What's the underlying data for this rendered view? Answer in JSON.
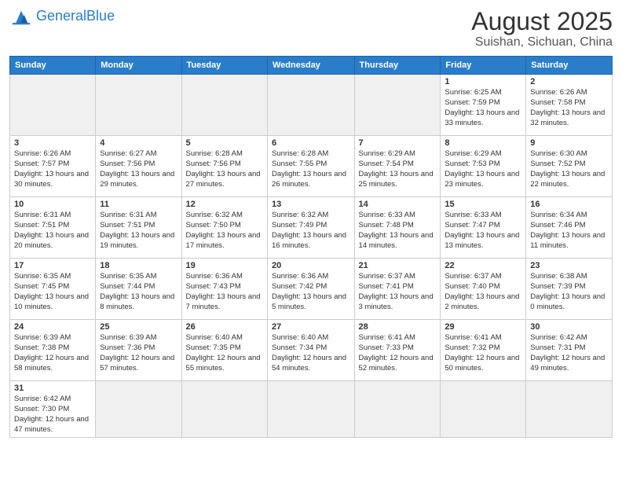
{
  "header": {
    "logo_general": "General",
    "logo_blue": "Blue",
    "title": "August 2025",
    "subtitle": "Suishan, Sichuan, China"
  },
  "days_of_week": [
    "Sunday",
    "Monday",
    "Tuesday",
    "Wednesday",
    "Thursday",
    "Friday",
    "Saturday"
  ],
  "weeks": [
    [
      {
        "day": "",
        "detail": ""
      },
      {
        "day": "",
        "detail": ""
      },
      {
        "day": "",
        "detail": ""
      },
      {
        "day": "",
        "detail": ""
      },
      {
        "day": "",
        "detail": ""
      },
      {
        "day": "1",
        "detail": "Sunrise: 6:25 AM\nSunset: 7:59 PM\nDaylight: 13 hours and 33 minutes."
      },
      {
        "day": "2",
        "detail": "Sunrise: 6:26 AM\nSunset: 7:58 PM\nDaylight: 13 hours and 32 minutes."
      }
    ],
    [
      {
        "day": "3",
        "detail": "Sunrise: 6:26 AM\nSunset: 7:57 PM\nDaylight: 13 hours and 30 minutes."
      },
      {
        "day": "4",
        "detail": "Sunrise: 6:27 AM\nSunset: 7:56 PM\nDaylight: 13 hours and 29 minutes."
      },
      {
        "day": "5",
        "detail": "Sunrise: 6:28 AM\nSunset: 7:56 PM\nDaylight: 13 hours and 27 minutes."
      },
      {
        "day": "6",
        "detail": "Sunrise: 6:28 AM\nSunset: 7:55 PM\nDaylight: 13 hours and 26 minutes."
      },
      {
        "day": "7",
        "detail": "Sunrise: 6:29 AM\nSunset: 7:54 PM\nDaylight: 13 hours and 25 minutes."
      },
      {
        "day": "8",
        "detail": "Sunrise: 6:29 AM\nSunset: 7:53 PM\nDaylight: 13 hours and 23 minutes."
      },
      {
        "day": "9",
        "detail": "Sunrise: 6:30 AM\nSunset: 7:52 PM\nDaylight: 13 hours and 22 minutes."
      }
    ],
    [
      {
        "day": "10",
        "detail": "Sunrise: 6:31 AM\nSunset: 7:51 PM\nDaylight: 13 hours and 20 minutes."
      },
      {
        "day": "11",
        "detail": "Sunrise: 6:31 AM\nSunset: 7:51 PM\nDaylight: 13 hours and 19 minutes."
      },
      {
        "day": "12",
        "detail": "Sunrise: 6:32 AM\nSunset: 7:50 PM\nDaylight: 13 hours and 17 minutes."
      },
      {
        "day": "13",
        "detail": "Sunrise: 6:32 AM\nSunset: 7:49 PM\nDaylight: 13 hours and 16 minutes."
      },
      {
        "day": "14",
        "detail": "Sunrise: 6:33 AM\nSunset: 7:48 PM\nDaylight: 13 hours and 14 minutes."
      },
      {
        "day": "15",
        "detail": "Sunrise: 6:33 AM\nSunset: 7:47 PM\nDaylight: 13 hours and 13 minutes."
      },
      {
        "day": "16",
        "detail": "Sunrise: 6:34 AM\nSunset: 7:46 PM\nDaylight: 13 hours and 11 minutes."
      }
    ],
    [
      {
        "day": "17",
        "detail": "Sunrise: 6:35 AM\nSunset: 7:45 PM\nDaylight: 13 hours and 10 minutes."
      },
      {
        "day": "18",
        "detail": "Sunrise: 6:35 AM\nSunset: 7:44 PM\nDaylight: 13 hours and 8 minutes."
      },
      {
        "day": "19",
        "detail": "Sunrise: 6:36 AM\nSunset: 7:43 PM\nDaylight: 13 hours and 7 minutes."
      },
      {
        "day": "20",
        "detail": "Sunrise: 6:36 AM\nSunset: 7:42 PM\nDaylight: 13 hours and 5 minutes."
      },
      {
        "day": "21",
        "detail": "Sunrise: 6:37 AM\nSunset: 7:41 PM\nDaylight: 13 hours and 3 minutes."
      },
      {
        "day": "22",
        "detail": "Sunrise: 6:37 AM\nSunset: 7:40 PM\nDaylight: 13 hours and 2 minutes."
      },
      {
        "day": "23",
        "detail": "Sunrise: 6:38 AM\nSunset: 7:39 PM\nDaylight: 13 hours and 0 minutes."
      }
    ],
    [
      {
        "day": "24",
        "detail": "Sunrise: 6:39 AM\nSunset: 7:38 PM\nDaylight: 12 hours and 58 minutes."
      },
      {
        "day": "25",
        "detail": "Sunrise: 6:39 AM\nSunset: 7:36 PM\nDaylight: 12 hours and 57 minutes."
      },
      {
        "day": "26",
        "detail": "Sunrise: 6:40 AM\nSunset: 7:35 PM\nDaylight: 12 hours and 55 minutes."
      },
      {
        "day": "27",
        "detail": "Sunrise: 6:40 AM\nSunset: 7:34 PM\nDaylight: 12 hours and 54 minutes."
      },
      {
        "day": "28",
        "detail": "Sunrise: 6:41 AM\nSunset: 7:33 PM\nDaylight: 12 hours and 52 minutes."
      },
      {
        "day": "29",
        "detail": "Sunrise: 6:41 AM\nSunset: 7:32 PM\nDaylight: 12 hours and 50 minutes."
      },
      {
        "day": "30",
        "detail": "Sunrise: 6:42 AM\nSunset: 7:31 PM\nDaylight: 12 hours and 49 minutes."
      }
    ],
    [
      {
        "day": "31",
        "detail": "Sunrise: 6:42 AM\nSunset: 7:30 PM\nDaylight: 12 hours and 47 minutes."
      },
      {
        "day": "",
        "detail": ""
      },
      {
        "day": "",
        "detail": ""
      },
      {
        "day": "",
        "detail": ""
      },
      {
        "day": "",
        "detail": ""
      },
      {
        "day": "",
        "detail": ""
      },
      {
        "day": "",
        "detail": ""
      }
    ]
  ]
}
